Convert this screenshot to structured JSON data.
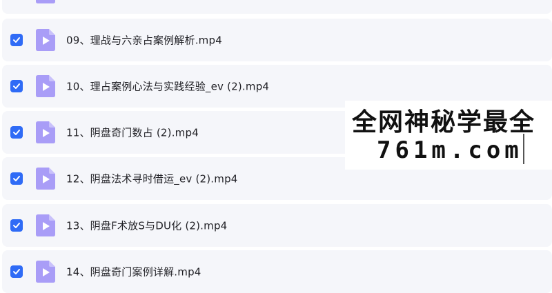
{
  "files": [
    {
      "name": ""
    },
    {
      "name": "09、理战与六亲占案例解析.mp4"
    },
    {
      "name": "10、理占案例心法与实践经验_ev (2).mp4"
    },
    {
      "name": "11、阴盘奇门数占 (2).mp4"
    },
    {
      "name": "12、阴盘法术寻时借运_ev (2).mp4"
    },
    {
      "name": "13、阴盘F术放S与DU化 (2).mp4"
    },
    {
      "name": "14、阴盘奇门案例详解.mp4"
    }
  ],
  "watermark": {
    "line1": "全网神秘学最全",
    "line2": "761m.com"
  },
  "colors": {
    "checkbox": "#2f6bf6",
    "file_icon": "#a99df7",
    "row_bg": "#f5f6fa"
  },
  "icons": {
    "checkbox": "checkmark-icon",
    "file": "video-file-icon"
  }
}
